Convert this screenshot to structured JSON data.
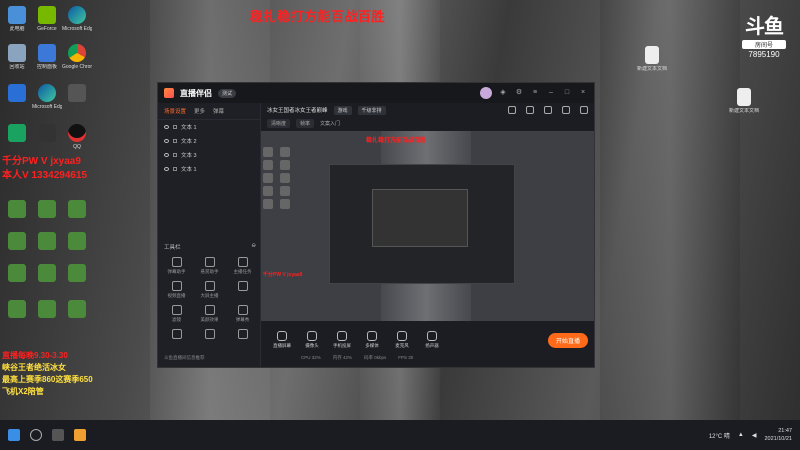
{
  "overlay": {
    "headline": "稳扎稳打方能百战百胜",
    "contact_line1": "千分PW V  jxyaa9",
    "contact_line2": "本人V 1334294615",
    "schedule_line1": "直播每晚9.30-3.30",
    "schedule_line2": "峡谷王者绝活冰女",
    "schedule_line3": "最高上赛季860这赛季650",
    "schedule_line4": "飞机X2陪管"
  },
  "douyu": {
    "mark": "斗鱼",
    "badge": "房间号",
    "room_id": "7895190"
  },
  "desktop": {
    "left_icons": [
      "此电脑",
      "GeForce",
      "Microsoft Edge",
      "回收站",
      "控制面板",
      "Google Chrome",
      "",
      "Microsoft Edge",
      "",
      "",
      "",
      "QQ"
    ],
    "right_icons": [
      "新建文本文档",
      "新建文本文档"
    ]
  },
  "app": {
    "name": "直播伴侣",
    "version": "测试",
    "left_tabs": [
      "场景设置",
      "更多",
      "弹幕"
    ],
    "scenes": [
      "文本 1",
      "文本 2",
      "文本 3",
      "文本 1"
    ],
    "tools_label": "工具栏",
    "tools": [
      "弹幕助手",
      "悬赏助手",
      "主播任务",
      "视频直播",
      "大屏主播",
      "",
      "滤镜",
      "美颜效果",
      "弹幕秀",
      "",
      "",
      ""
    ],
    "bottom_hint": "斗鱼直播间信息推荐",
    "header_title": "冰女王国者冰女王者巅峰",
    "header_pill": "游戏",
    "header_pill2": "千级非排",
    "sub_pill1": "清晰度",
    "sub_pill2": "帧率",
    "sub_text": "文案入门",
    "controls": [
      "直播屏幕",
      "摄像头",
      "手机投屏",
      "多媒体",
      "麦克风",
      "扬声器"
    ],
    "go_live": "开始直播",
    "status": [
      "CPU 32%",
      "内存 42%",
      "码率 0kbps",
      "FPS 30"
    ]
  },
  "taskbar": {
    "weather": "12°C 晴",
    "time": "21:47",
    "date": "2021/10/21"
  }
}
